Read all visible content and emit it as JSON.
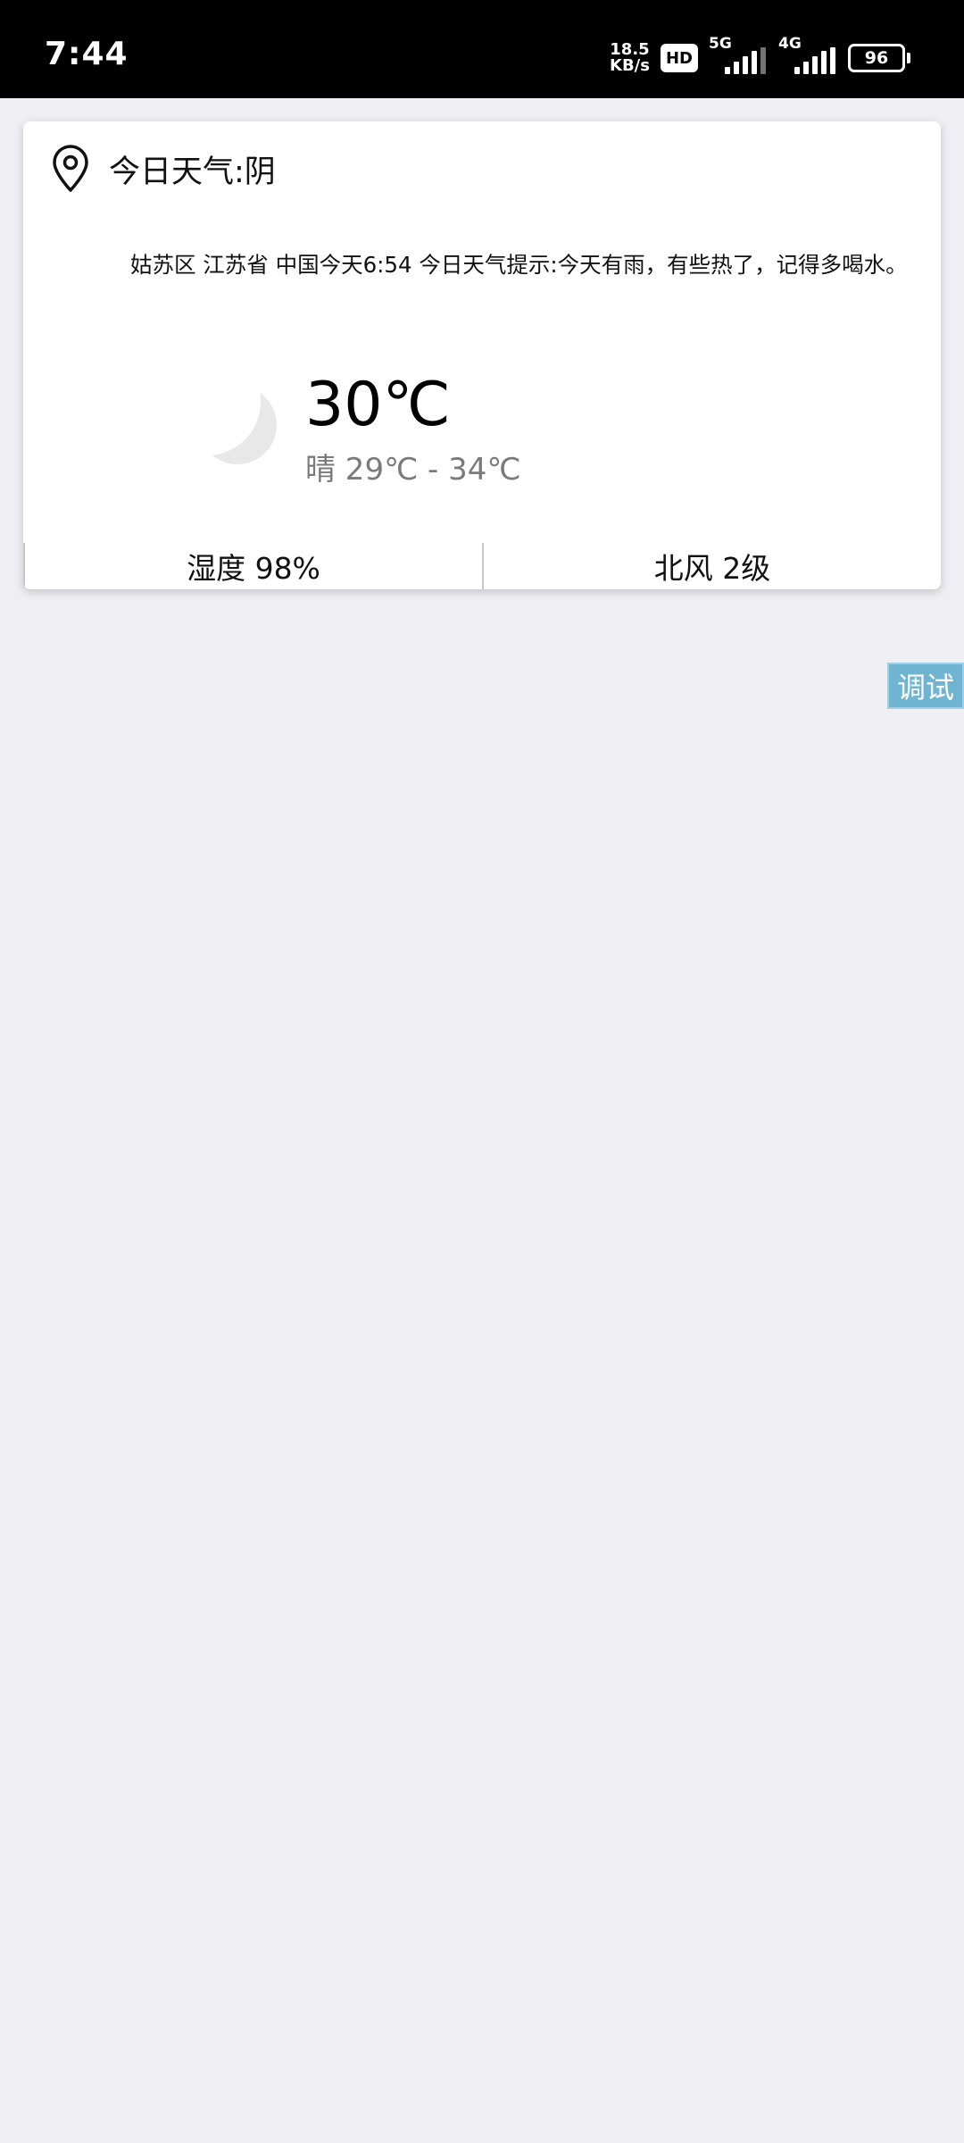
{
  "status_bar": {
    "time": "7:44",
    "net_speed_value": "18.5",
    "net_speed_unit": "KB/s",
    "hd_badge": "HD",
    "network_1": "5G",
    "network_2": "4G",
    "battery": "96"
  },
  "weather_card": {
    "title": "今日天气:阴",
    "tip": "姑苏区 江苏省 中国今天6:54 今日天气提示:今天有雨，有些热了，记得多喝水。",
    "current_temp": "30℃",
    "range": "晴 29℃ - 34℃",
    "condition_icon": "moon-icon",
    "humidity": "湿度 98%",
    "wind": "北风 2级"
  },
  "debug_button": {
    "label": "调试",
    "color": "#6fb5d1"
  }
}
